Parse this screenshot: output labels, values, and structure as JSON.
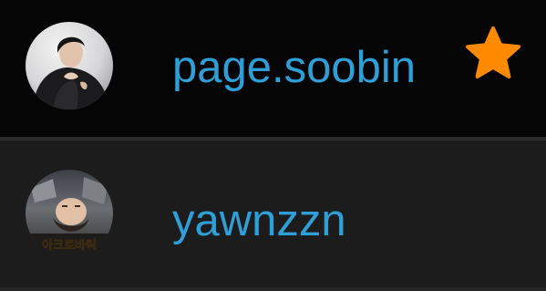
{
  "accounts": [
    {
      "username": "page.soobin",
      "avatar_icon": "profile-photo-dark-outfit",
      "favorite": true,
      "favorite_icon": "star-icon"
    },
    {
      "username": "yawnzzn",
      "avatar_icon": "profile-photo-upside-down-face",
      "avatar_caption": "아크로바틱",
      "favorite": false
    }
  ],
  "colors": {
    "username_text": "#2f9fd7",
    "star_fill": "#ff8a00",
    "row_selected_bg": "#050505",
    "row_bg": "#1c1c1c"
  }
}
